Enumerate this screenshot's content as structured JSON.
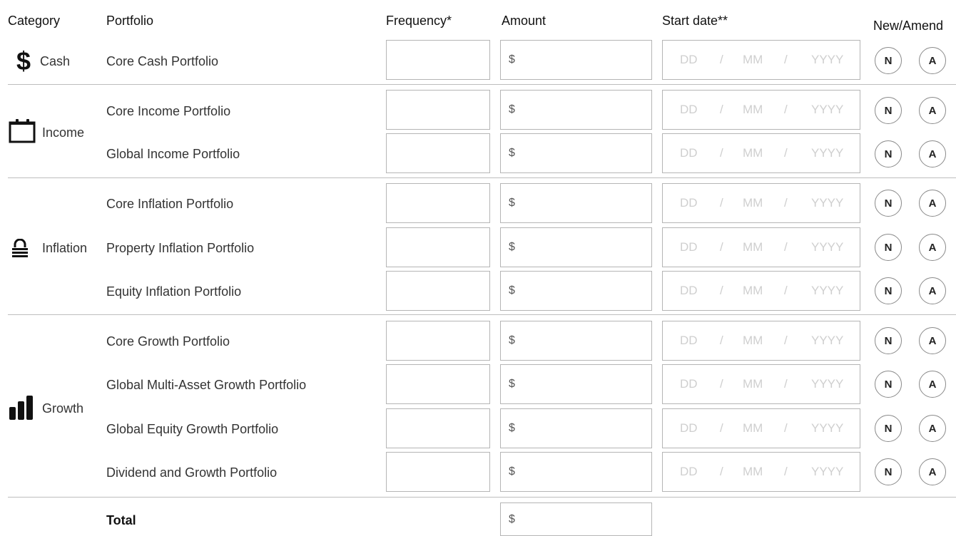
{
  "headers": {
    "category": "Category",
    "portfolio": "Portfolio",
    "frequency": "Frequency*",
    "amount": "Amount",
    "start_date": "Start date**",
    "new_amend": "New/Amend"
  },
  "categories": [
    {
      "label": "Cash",
      "icon": "dollar-icon"
    },
    {
      "label": "Income",
      "icon": "calendar-icon"
    },
    {
      "label": "Inflation",
      "icon": "lock-icon"
    },
    {
      "label": "Growth",
      "icon": "bar-chart-icon"
    }
  ],
  "rows": [
    {
      "portfolio": "Core Cash Portfolio",
      "currency": "$",
      "dd": "DD",
      "mm": "MM",
      "yyyy": "YYYY",
      "sep": "/",
      "new": "N",
      "amend": "A"
    },
    {
      "portfolio": "Core Income Portfolio",
      "currency": "$",
      "dd": "DD",
      "mm": "MM",
      "yyyy": "YYYY",
      "sep": "/",
      "new": "N",
      "amend": "A"
    },
    {
      "portfolio": "Global Income Portfolio",
      "currency": "$",
      "dd": "DD",
      "mm": "MM",
      "yyyy": "YYYY",
      "sep": "/",
      "new": "N",
      "amend": "A"
    },
    {
      "portfolio": "Core Inflation Portfolio",
      "currency": "$",
      "dd": "DD",
      "mm": "MM",
      "yyyy": "YYYY",
      "sep": "/",
      "new": "N",
      "amend": "A"
    },
    {
      "portfolio": "Property Inflation Portfolio",
      "currency": "$",
      "dd": "DD",
      "mm": "MM",
      "yyyy": "YYYY",
      "sep": "/",
      "new": "N",
      "amend": "A"
    },
    {
      "portfolio": "Equity Inflation Portfolio",
      "currency": "$",
      "dd": "DD",
      "mm": "MM",
      "yyyy": "YYYY",
      "sep": "/",
      "new": "N",
      "amend": "A"
    },
    {
      "portfolio": "Core Growth Portfolio",
      "currency": "$",
      "dd": "DD",
      "mm": "MM",
      "yyyy": "YYYY",
      "sep": "/",
      "new": "N",
      "amend": "A"
    },
    {
      "portfolio": "Global Multi-Asset Growth Portfolio",
      "currency": "$",
      "dd": "DD",
      "mm": "MM",
      "yyyy": "YYYY",
      "sep": "/",
      "new": "N",
      "amend": "A"
    },
    {
      "portfolio": "Global Equity Growth Portfolio",
      "currency": "$",
      "dd": "DD",
      "mm": "MM",
      "yyyy": "YYYY",
      "sep": "/",
      "new": "N",
      "amend": "A"
    },
    {
      "portfolio": "Dividend and Growth Portfolio",
      "currency": "$",
      "dd": "DD",
      "mm": "MM",
      "yyyy": "YYYY",
      "sep": "/",
      "new": "N",
      "amend": "A"
    }
  ],
  "total": {
    "label": "Total",
    "currency": "$"
  },
  "colors": {
    "text": "#1b1b1b",
    "border": "#b5b5b5",
    "placeholder": "#cfcfcf"
  }
}
